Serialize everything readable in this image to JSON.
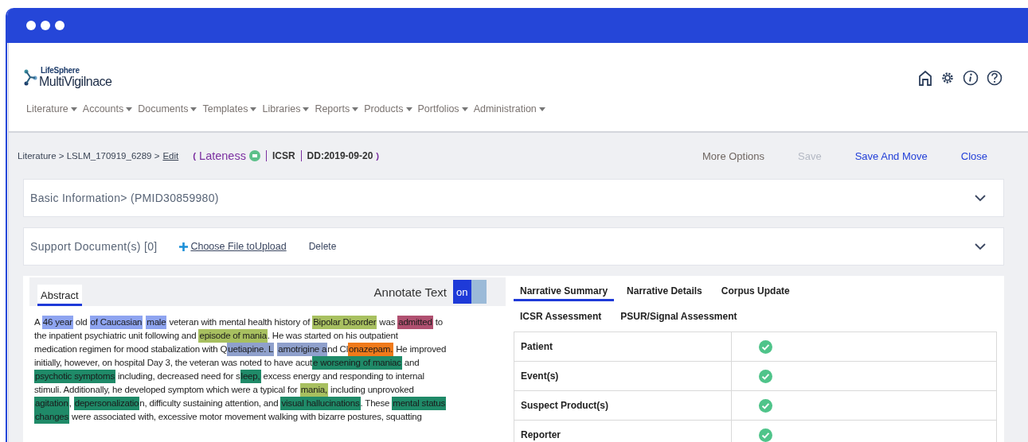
{
  "app": {
    "brand_small": "LifeSphere",
    "brand": "MultiVigilnace"
  },
  "nav": [
    {
      "label": "Literature"
    },
    {
      "label": "Accounts"
    },
    {
      "label": "Documents"
    },
    {
      "label": "Templates"
    },
    {
      "label": "Libraries"
    },
    {
      "label": "Reports"
    },
    {
      "label": "Products"
    },
    {
      "label": "Portfolios"
    },
    {
      "label": "Administration"
    }
  ],
  "breadcrumb": {
    "path": "Literature > LSLM_170919_6289 >",
    "link": "Edit",
    "open": "(",
    "close": ")",
    "status": "Lateness",
    "type": "ICSR",
    "due": "DD:2019-09-20"
  },
  "actions": [
    {
      "label": "More Options",
      "kind": "muted"
    },
    {
      "label": "Save",
      "kind": "disabled"
    },
    {
      "label": "Save And Move",
      "kind": "link"
    },
    {
      "label": "Close",
      "kind": "link"
    }
  ],
  "sections": [
    {
      "title": "Basic Information> (PMID30859980)",
      "expanded": false
    },
    {
      "title": "Support Document(s) [0]",
      "expanded": false,
      "upload": "Choose File toUpload",
      "delete": "Delete"
    }
  ],
  "abstract": {
    "tab": "Abstract",
    "annotate_label": "Annotate Text",
    "annotate_on": true,
    "toggle_text": "on",
    "lines": [
      [
        {
          "text": "A "
        },
        {
          "text": "46 year",
          "color": "#8ea4f0"
        },
        {
          "text": " old "
        },
        {
          "text": "of Caucasian",
          "color": "#8ea4f0"
        },
        {
          "text": "male",
          "color": "#8ea4f0"
        },
        {
          "text": " veteran with mental health history of "
        },
        {
          "text": "Bipolar Disorder",
          "color": "#a8c060"
        },
        {
          "text": " was "
        },
        {
          "text": "admitted",
          "color": "#b05070"
        },
        {
          "text": " to"
        }
      ],
      [
        {
          "text": "the inpatient psychiatric unit following and "
        },
        {
          "text": "episode of mania",
          "color": "#a8c060"
        },
        {
          "text": ". He was started on his outpatient"
        }
      ],
      [
        {
          "text": "medication regimen for mood stabalization with Q"
        },
        {
          "text": "uetiapine. L",
          "color": "#8fa0cc"
        },
        {
          "text": "amotrigine a",
          "color": "#8fa0cc"
        },
        {
          "text": "nd Cl"
        },
        {
          "text": "onazepam.",
          "color": "#f07a1a"
        },
        {
          "text": " He improved"
        }
      ],
      [
        {
          "text": "initially, however, on hospital Day 3, the veteran was noted to have acut"
        },
        {
          "text": "e worsening of maniac",
          "color": "#1f8a68"
        },
        {
          "text": " and"
        }
      ],
      [
        {
          "text": "psychotic symptoms",
          "color": "#1f8a68"
        },
        {
          "text": " including, decreased need for s"
        },
        {
          "text": "leep,",
          "color": "#1f8a68"
        },
        {
          "text": " excess energy and responding to internal"
        }
      ],
      [
        {
          "text": "stimuli. Additionally, he developed symptom which were a typical for "
        },
        {
          "text": "mania,",
          "color": "#a8c060"
        },
        {
          "text": " including unprovoked"
        }
      ],
      [
        {
          "text": "agitation",
          "color": "#1f8a68"
        },
        {
          "text": ", "
        },
        {
          "text": "depersonalizatio",
          "color": "#1f8a68"
        },
        {
          "text": "n, difficulty sustaining attention, and "
        },
        {
          "text": "visual hallucinations",
          "color": "#1f8a68"
        },
        {
          "text": ". These "
        },
        {
          "text": "mental status",
          "color": "#1f8a68"
        }
      ],
      [
        {
          "text": "changes",
          "color": "#1f8a68"
        },
        {
          "text": " were associated with, excessive motor movement walking with bizarre postures, squatting"
        }
      ]
    ]
  },
  "narrative": {
    "tabs": [
      {
        "label": "Narrative Summary",
        "selected": true
      },
      {
        "label": "Narrative Details",
        "selected": false
      },
      {
        "label": "Corpus Update",
        "selected": false
      },
      {
        "label": "ICSR Assessment",
        "selected": false
      },
      {
        "label": "PSUR/Signal Assessment",
        "selected": false
      }
    ],
    "rows": [
      {
        "label": "Patient",
        "complete": true
      },
      {
        "label": "Event(s)",
        "complete": true
      },
      {
        "label": "Suspect Product(s)",
        "complete": true
      },
      {
        "label": "Reporter",
        "complete": true
      }
    ]
  }
}
